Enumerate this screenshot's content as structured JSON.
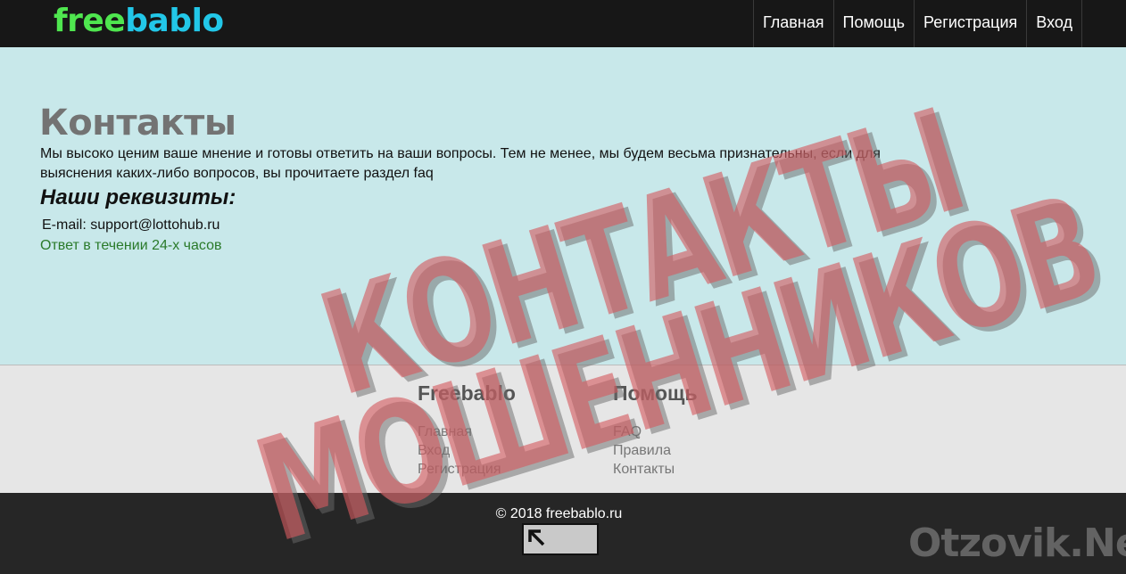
{
  "header": {
    "logo_part1": "free",
    "logo_part2": "bablo",
    "nav": [
      "Главная",
      "Помощь",
      "Регистрация",
      "Вход"
    ]
  },
  "main": {
    "title": "Контакты",
    "intro": "Мы высоко ценим ваше мнение и готовы ответить на ваши вопросы. Тем не менее, мы будем весьма признательны, если для выяснения каких-либо вопросов, вы прочитаете раздел faq",
    "requisites_heading": "Наши реквизиты:",
    "email_label": "E-mail:",
    "email_value": "support@lottohub.ru",
    "reply_time": "Ответ в течении 24-х часов"
  },
  "footer": {
    "col1": {
      "title": "Freebablo",
      "links": [
        "Главная",
        "Вход",
        "Регистрация"
      ]
    },
    "col2": {
      "title": "Помощь",
      "links": [
        "FAQ",
        "Правила",
        "Контакты"
      ]
    },
    "copyright": "© 2018 freebablo.ru"
  },
  "watermark": {
    "line1": "КОНТАКТЫ",
    "line2": "МОШЕННИКОВ",
    "site": "Otzovik.Net"
  },
  "colors": {
    "logo_green": "#4fe64f",
    "logo_blue": "#22c7e8",
    "main_bg": "#c8e8ea",
    "stamp": "#d45a5f"
  }
}
